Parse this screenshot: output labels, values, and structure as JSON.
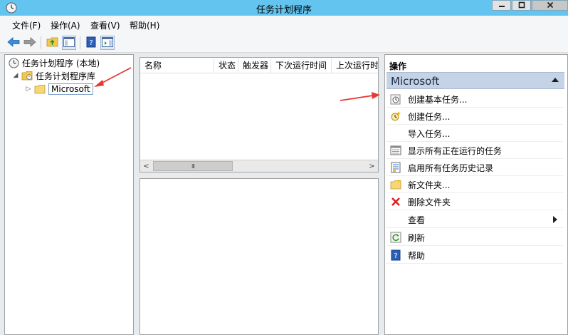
{
  "window": {
    "title": "任务计划程序"
  },
  "menu": [
    {
      "label": "文件(F)"
    },
    {
      "label": "操作(A)"
    },
    {
      "label": "查看(V)"
    },
    {
      "label": "帮助(H)"
    }
  ],
  "tree": {
    "root": "任务计划程序 (本地)",
    "library": "任务计划程序库",
    "microsoft": "Microsoft"
  },
  "columns": [
    "名称",
    "状态",
    "触发器",
    "下次运行时间",
    "上次运行时"
  ],
  "scroll": {
    "thumb": "III"
  },
  "actions": {
    "header": "操作",
    "section": "Microsoft",
    "items": [
      {
        "label": "创建基本任务...",
        "icon": "create-basic-task-icon"
      },
      {
        "label": "创建任务...",
        "icon": "create-task-icon"
      },
      {
        "label": "导入任务...",
        "icon": ""
      },
      {
        "label": "显示所有正在运行的任务",
        "icon": "running-tasks-icon"
      },
      {
        "label": "启用所有任务历史记录",
        "icon": "history-icon"
      },
      {
        "label": "新文件夹...",
        "icon": "new-folder-icon"
      },
      {
        "label": "删除文件夹",
        "icon": "delete-icon"
      },
      {
        "label": "查看",
        "icon": ""
      },
      {
        "label": "刷新",
        "icon": "refresh-icon"
      },
      {
        "label": "帮助",
        "icon": "help-icon"
      }
    ]
  },
  "colors": {
    "titlebar": "#63c4f0",
    "section_header": "#c4d3e6",
    "annotation_arrow": "#e53935"
  }
}
